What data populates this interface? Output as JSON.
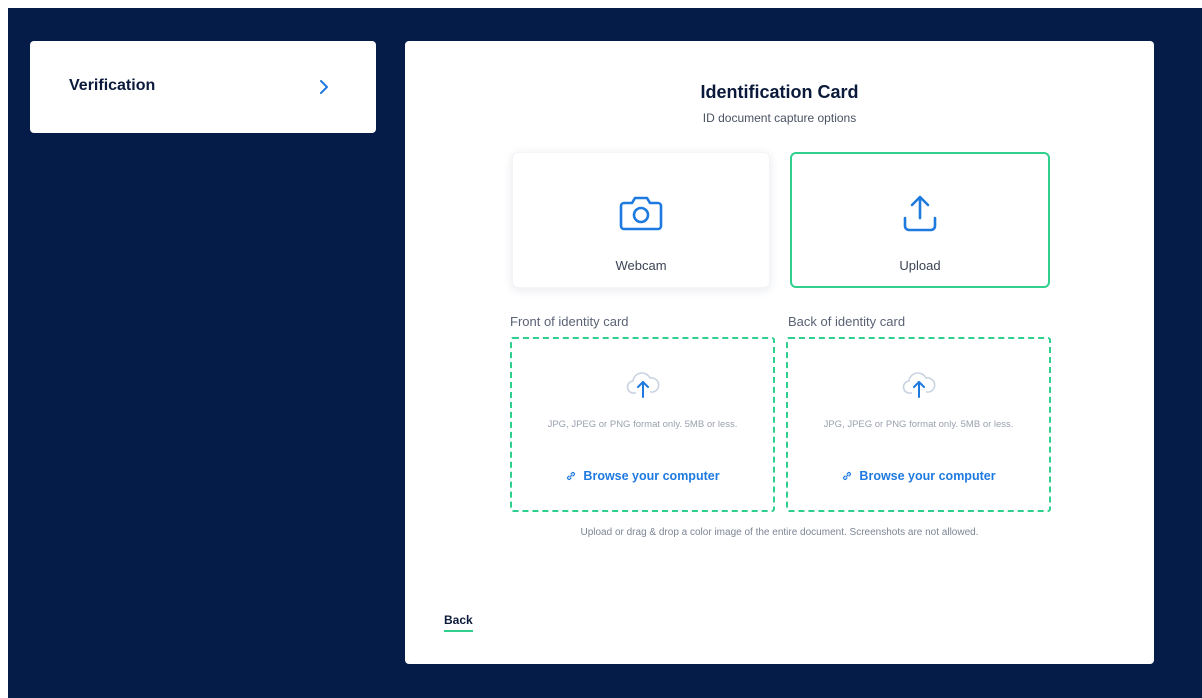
{
  "sidebar": {
    "items": [
      {
        "label": "Verification",
        "icon": "chevron-right-icon"
      }
    ]
  },
  "main": {
    "title": "Identification Card",
    "subtitle": "ID document capture options",
    "options": [
      {
        "label": "Webcam",
        "icon": "camera-icon",
        "selected": false
      },
      {
        "label": "Upload",
        "icon": "upload-icon",
        "selected": true
      }
    ],
    "front": {
      "label": "Front of identity card",
      "hint": "JPG, JPEG or PNG format only. 5MB or less.",
      "browse": "Browse your computer"
    },
    "back_side": {
      "label": "Back of identity card",
      "hint": "JPG, JPEG or PNG format only. 5MB or less.",
      "browse": "Browse your computer"
    },
    "footnote": "Upload or drag & drop a color image of the entire document. Screenshots are not allowed.",
    "back_button": "Back"
  },
  "colors": {
    "background": "#051b48",
    "accent_green": "#2fcf8e",
    "accent_blue": "#1f7ae0"
  }
}
